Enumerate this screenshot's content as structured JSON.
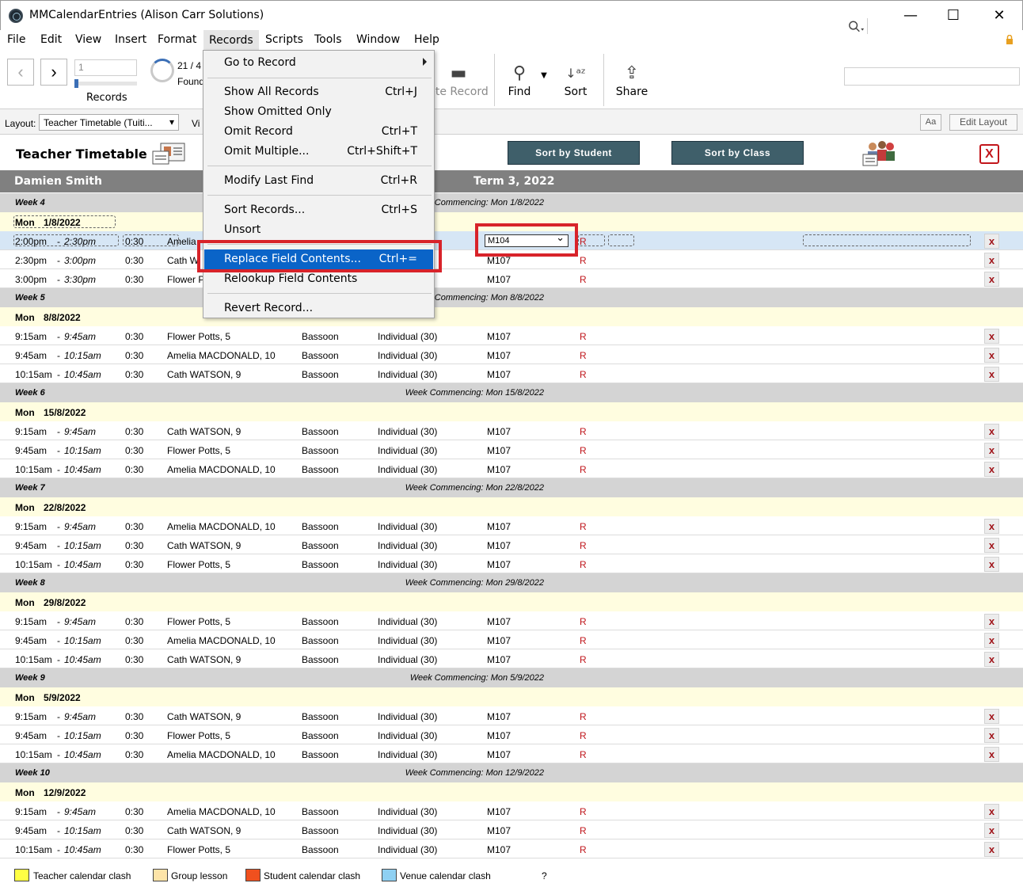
{
  "window": {
    "title": "MMCalendarEntries (Alison Carr Solutions)",
    "minimize": "—",
    "maximize": "☐",
    "close": "✕"
  },
  "menubar": [
    "File",
    "Edit",
    "View",
    "Insert",
    "Format",
    "Records",
    "Scripts",
    "Tools",
    "Window",
    "Help"
  ],
  "toolbar": {
    "record_number": "1",
    "records_label": "Records",
    "found_count": "21 / 4",
    "found_label": "Found",
    "delete_record": "ete Record",
    "find": "Find",
    "sort": "Sort",
    "share": "Share",
    "prev_glyph": "‹",
    "next_glyph": "›"
  },
  "layoutbar": {
    "label": "Layout:",
    "layout_name": "Teacher Timetable (Tuiti...",
    "view_label": "Vi",
    "aa": "Aa",
    "edit_layout": "Edit Layout"
  },
  "header": {
    "title": "Teacher Timetable",
    "sort_student": "Sort by Student",
    "sort_class": "Sort by Class",
    "close_label": "X",
    "teacher": "Damien Smith",
    "term": "Term 3, 2022"
  },
  "records_menu": {
    "items": [
      {
        "label": "Go to Record",
        "shortcut": "",
        "submenu": true
      },
      {
        "label": "Show All Records",
        "shortcut": "Ctrl+J"
      },
      {
        "label": "Show Omitted Only",
        "shortcut": ""
      },
      {
        "label": "Omit Record",
        "shortcut": "Ctrl+T"
      },
      {
        "label": "Omit Multiple...",
        "shortcut": "Ctrl+Shift+T"
      },
      {
        "label": "Modify Last Find",
        "shortcut": "Ctrl+R"
      },
      {
        "label": "Sort Records...",
        "shortcut": "Ctrl+S"
      },
      {
        "label": "Unsort",
        "shortcut": ""
      },
      {
        "label": "Replace Field Contents...",
        "shortcut": "Ctrl+=",
        "active": true
      },
      {
        "label": "Relookup Field Contents",
        "shortcut": ""
      },
      {
        "label": "Revert Record...",
        "shortcut": ""
      }
    ]
  },
  "timetable": {
    "weeks": [
      {
        "week": "Week 4",
        "commencing": "Week Commencing: Mon 1/8/2022",
        "day": "Mon",
        "date": "1/8/2022",
        "entries": [
          {
            "start": "2:00pm",
            "end": "2:30pm",
            "dur": "0:30",
            "student": "Amelia",
            "instrument": "",
            "type": "",
            "room": "M104",
            "flag": "R"
          },
          {
            "start": "2:30pm",
            "end": "3:00pm",
            "dur": "0:30",
            "student": "Cath W",
            "instrument": "",
            "type": "",
            "room": "M107",
            "flag": "R"
          },
          {
            "start": "3:00pm",
            "end": "3:30pm",
            "dur": "0:30",
            "student": "Flower P",
            "instrument": "",
            "type": "",
            "room": "M107",
            "flag": "R"
          }
        ]
      },
      {
        "week": "Week 5",
        "commencing": "Week Commencing: Mon 8/8/2022",
        "day": "Mon",
        "date": "8/8/2022",
        "entries": [
          {
            "start": "9:15am",
            "end": "9:45am",
            "dur": "0:30",
            "student": "Flower Potts, 5",
            "instrument": "Bassoon",
            "type": "Individual (30)",
            "room": "M107",
            "flag": "R"
          },
          {
            "start": "9:45am",
            "end": "10:15am",
            "dur": "0:30",
            "student": "Amelia MACDONALD, 10",
            "instrument": "Bassoon",
            "type": "Individual (30)",
            "room": "M107",
            "flag": "R"
          },
          {
            "start": "10:15am",
            "end": "10:45am",
            "dur": "0:30",
            "student": "Cath WATSON, 9",
            "instrument": "Bassoon",
            "type": "Individual (30)",
            "room": "M107",
            "flag": "R"
          }
        ]
      },
      {
        "week": "Week 6",
        "commencing": "Week Commencing: Mon 15/8/2022",
        "day": "Mon",
        "date": "15/8/2022",
        "entries": [
          {
            "start": "9:15am",
            "end": "9:45am",
            "dur": "0:30",
            "student": "Cath WATSON, 9",
            "instrument": "Bassoon",
            "type": "Individual (30)",
            "room": "M107",
            "flag": "R"
          },
          {
            "start": "9:45am",
            "end": "10:15am",
            "dur": "0:30",
            "student": "Flower Potts, 5",
            "instrument": "Bassoon",
            "type": "Individual (30)",
            "room": "M107",
            "flag": "R"
          },
          {
            "start": "10:15am",
            "end": "10:45am",
            "dur": "0:30",
            "student": "Amelia MACDONALD, 10",
            "instrument": "Bassoon",
            "type": "Individual (30)",
            "room": "M107",
            "flag": "R"
          }
        ]
      },
      {
        "week": "Week 7",
        "commencing": "Week Commencing: Mon 22/8/2022",
        "day": "Mon",
        "date": "22/8/2022",
        "entries": [
          {
            "start": "9:15am",
            "end": "9:45am",
            "dur": "0:30",
            "student": "Amelia MACDONALD, 10",
            "instrument": "Bassoon",
            "type": "Individual (30)",
            "room": "M107",
            "flag": "R"
          },
          {
            "start": "9:45am",
            "end": "10:15am",
            "dur": "0:30",
            "student": "Cath WATSON, 9",
            "instrument": "Bassoon",
            "type": "Individual (30)",
            "room": "M107",
            "flag": "R"
          },
          {
            "start": "10:15am",
            "end": "10:45am",
            "dur": "0:30",
            "student": "Flower Potts, 5",
            "instrument": "Bassoon",
            "type": "Individual (30)",
            "room": "M107",
            "flag": "R"
          }
        ]
      },
      {
        "week": "Week 8",
        "commencing": "Week Commencing: Mon 29/8/2022",
        "day": "Mon",
        "date": "29/8/2022",
        "entries": [
          {
            "start": "9:15am",
            "end": "9:45am",
            "dur": "0:30",
            "student": "Flower Potts, 5",
            "instrument": "Bassoon",
            "type": "Individual (30)",
            "room": "M107",
            "flag": "R"
          },
          {
            "start": "9:45am",
            "end": "10:15am",
            "dur": "0:30",
            "student": "Amelia MACDONALD, 10",
            "instrument": "Bassoon",
            "type": "Individual (30)",
            "room": "M107",
            "flag": "R"
          },
          {
            "start": "10:15am",
            "end": "10:45am",
            "dur": "0:30",
            "student": "Cath WATSON, 9",
            "instrument": "Bassoon",
            "type": "Individual (30)",
            "room": "M107",
            "flag": "R"
          }
        ]
      },
      {
        "week": "Week 9",
        "commencing": "Week Commencing: Mon 5/9/2022",
        "day": "Mon",
        "date": "5/9/2022",
        "entries": [
          {
            "start": "9:15am",
            "end": "9:45am",
            "dur": "0:30",
            "student": "Cath WATSON, 9",
            "instrument": "Bassoon",
            "type": "Individual (30)",
            "room": "M107",
            "flag": "R"
          },
          {
            "start": "9:45am",
            "end": "10:15am",
            "dur": "0:30",
            "student": "Flower Potts, 5",
            "instrument": "Bassoon",
            "type": "Individual (30)",
            "room": "M107",
            "flag": "R"
          },
          {
            "start": "10:15am",
            "end": "10:45am",
            "dur": "0:30",
            "student": "Amelia MACDONALD, 10",
            "instrument": "Bassoon",
            "type": "Individual (30)",
            "room": "M107",
            "flag": "R"
          }
        ]
      },
      {
        "week": "Week 10",
        "commencing": "Week Commencing: Mon 12/9/2022",
        "day": "Mon",
        "date": "12/9/2022",
        "entries": [
          {
            "start": "9:15am",
            "end": "9:45am",
            "dur": "0:30",
            "student": "Amelia MACDONALD, 10",
            "instrument": "Bassoon",
            "type": "Individual (30)",
            "room": "M107",
            "flag": "R"
          },
          {
            "start": "9:45am",
            "end": "10:15am",
            "dur": "0:30",
            "student": "Cath WATSON, 9",
            "instrument": "Bassoon",
            "type": "Individual (30)",
            "room": "M107",
            "flag": "R"
          },
          {
            "start": "10:15am",
            "end": "10:45am",
            "dur": "0:30",
            "student": "Flower Potts, 5",
            "instrument": "Bassoon",
            "type": "Individual (30)",
            "room": "M107",
            "flag": "R"
          }
        ]
      }
    ],
    "delete_label": "x"
  },
  "legend": {
    "items": [
      {
        "label": "Teacher calendar clash",
        "color": "#ffff44"
      },
      {
        "label": "Group lesson",
        "color": "#fde4a8"
      },
      {
        "label": "Student calendar clash",
        "color": "#f0501e"
      },
      {
        "label": "Venue calendar clash",
        "color": "#8fd0f2"
      }
    ],
    "help": "?"
  },
  "colors": {
    "accent_blue": "#0a64c8",
    "teal_button": "#3f5f6a",
    "highlight_red": "#d8232a",
    "week_band": "#d4d4d4",
    "day_band": "#fffde0"
  }
}
